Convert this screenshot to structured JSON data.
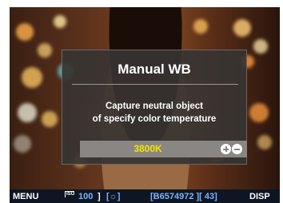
{
  "dialog": {
    "title": "Manual WB",
    "message_line1": "Capture neutral object",
    "message_line2": "of specify color temperature",
    "temperature_value": "3800K",
    "adjust_icons": "plus-minus-icon"
  },
  "status_bar": {
    "menu_label": "MENU",
    "iso_tag": "ISO",
    "iso_value": "100",
    "wb_icon": "sun-icon",
    "shots_code": "[B6574972 ][ 43]",
    "disp_label": "DISP"
  },
  "colors": {
    "dialog_bg": "#373432",
    "temp_bar_bg": "#8a8684",
    "temperature_text": "#f2e600",
    "status_bar_bg": "#0d1622",
    "status_highlight": "#7fb2ff"
  }
}
